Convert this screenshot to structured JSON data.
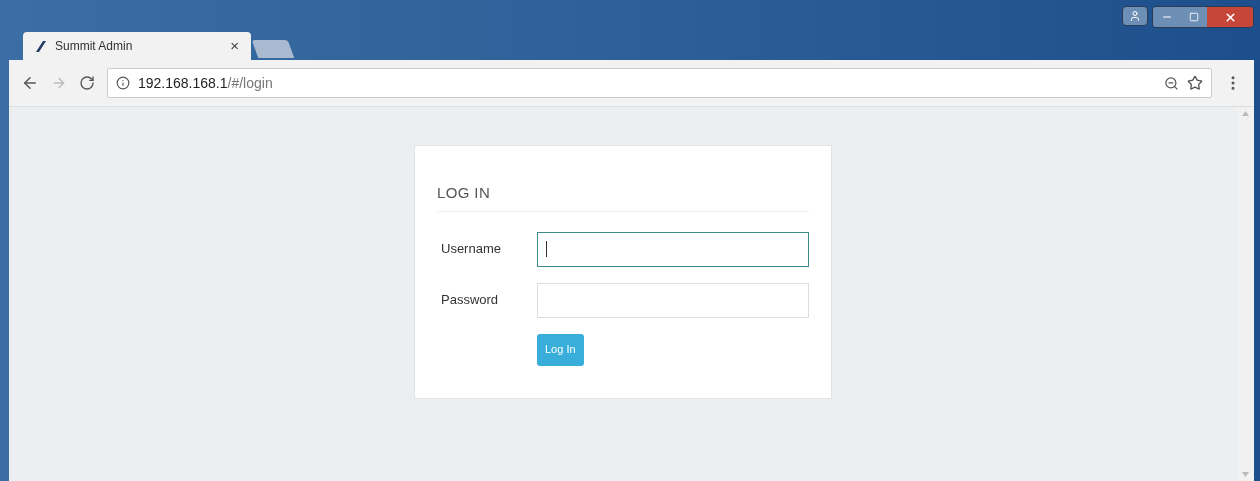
{
  "tab": {
    "title": "Summit Admin",
    "close": "×"
  },
  "address_bar": {
    "host": "192.168.168.1",
    "path": "/#/login"
  },
  "login": {
    "title": "LOG IN",
    "fields": [
      {
        "label": "Username",
        "focused": true
      },
      {
        "label": "Password",
        "focused": false
      }
    ],
    "button": "Log In"
  }
}
